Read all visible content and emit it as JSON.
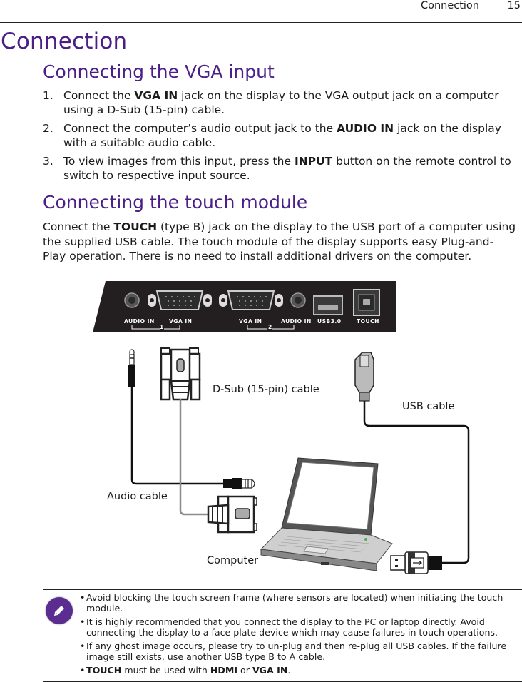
{
  "header": {
    "title": "Connection",
    "page_number": "15"
  },
  "chapter_title": "Connection",
  "vga_section": {
    "title": "Connecting the VGA input",
    "steps": [
      {
        "number": "1.",
        "pre": "Connect the ",
        "bold": "VGA IN",
        "post": " jack on the display to the VGA output jack on a computer using a D-Sub (15-pin) cable."
      },
      {
        "number": "2.",
        "pre": "Connect the computer’s audio output jack to the ",
        "bold": "AUDIO IN",
        "post": " jack on the display with a suitable audio cable."
      },
      {
        "number": "3.",
        "pre": "To view images from this input, press the ",
        "bold": "INPUT",
        "post": " button on the remote control to switch to respective input source."
      }
    ]
  },
  "touch_section": {
    "title": "Connecting the touch module",
    "pre": "Connect the ",
    "bold": "TOUCH",
    "post": " (type B) jack on the display to the USB port of a computer using the supplied USB cable. The touch module of the display supports easy Plug-and-Play operation. There is no need to install additional drivers on the computer."
  },
  "diagram": {
    "panel_labels": {
      "audio_in_1": "AUDIO IN",
      "vga_in_1": "VGA IN",
      "group_1": "1",
      "vga_in_2": "VGA IN",
      "audio_in_2": "AUDIO IN",
      "group_2": "2",
      "usb": "USB3.0",
      "touch": "TOUCH"
    },
    "callouts": {
      "dsub": "D-Sub (15-pin) cable",
      "usb": "USB cable",
      "audio": "Audio cable",
      "computer": "Computer"
    },
    "colors": {
      "panel": "#231f20",
      "vga_cable": "#8c8c8c",
      "audio_cable": "#1a1a1a"
    }
  },
  "note": {
    "icon": "pencil-icon",
    "accent_color": "#5b2d90",
    "items": [
      {
        "text": "Avoid blocking the touch screen frame (where sensors are located) when initiating the touch module."
      },
      {
        "text": "It is highly recommended that you connect the display to the PC or laptop directly. Avoid connecting the display to a face plate device which may cause failures in touch operations."
      },
      {
        "text": "If any ghost image occurs, please try to un-plug and then re-plug all USB cables. If the failure image still exists, use another USB type B to A cable."
      },
      {
        "b1": "TOUCH",
        "t1": " must be used with ",
        "b2": "HDMI",
        "t2": " or ",
        "b3": "VGA IN",
        "t3": "."
      }
    ]
  }
}
